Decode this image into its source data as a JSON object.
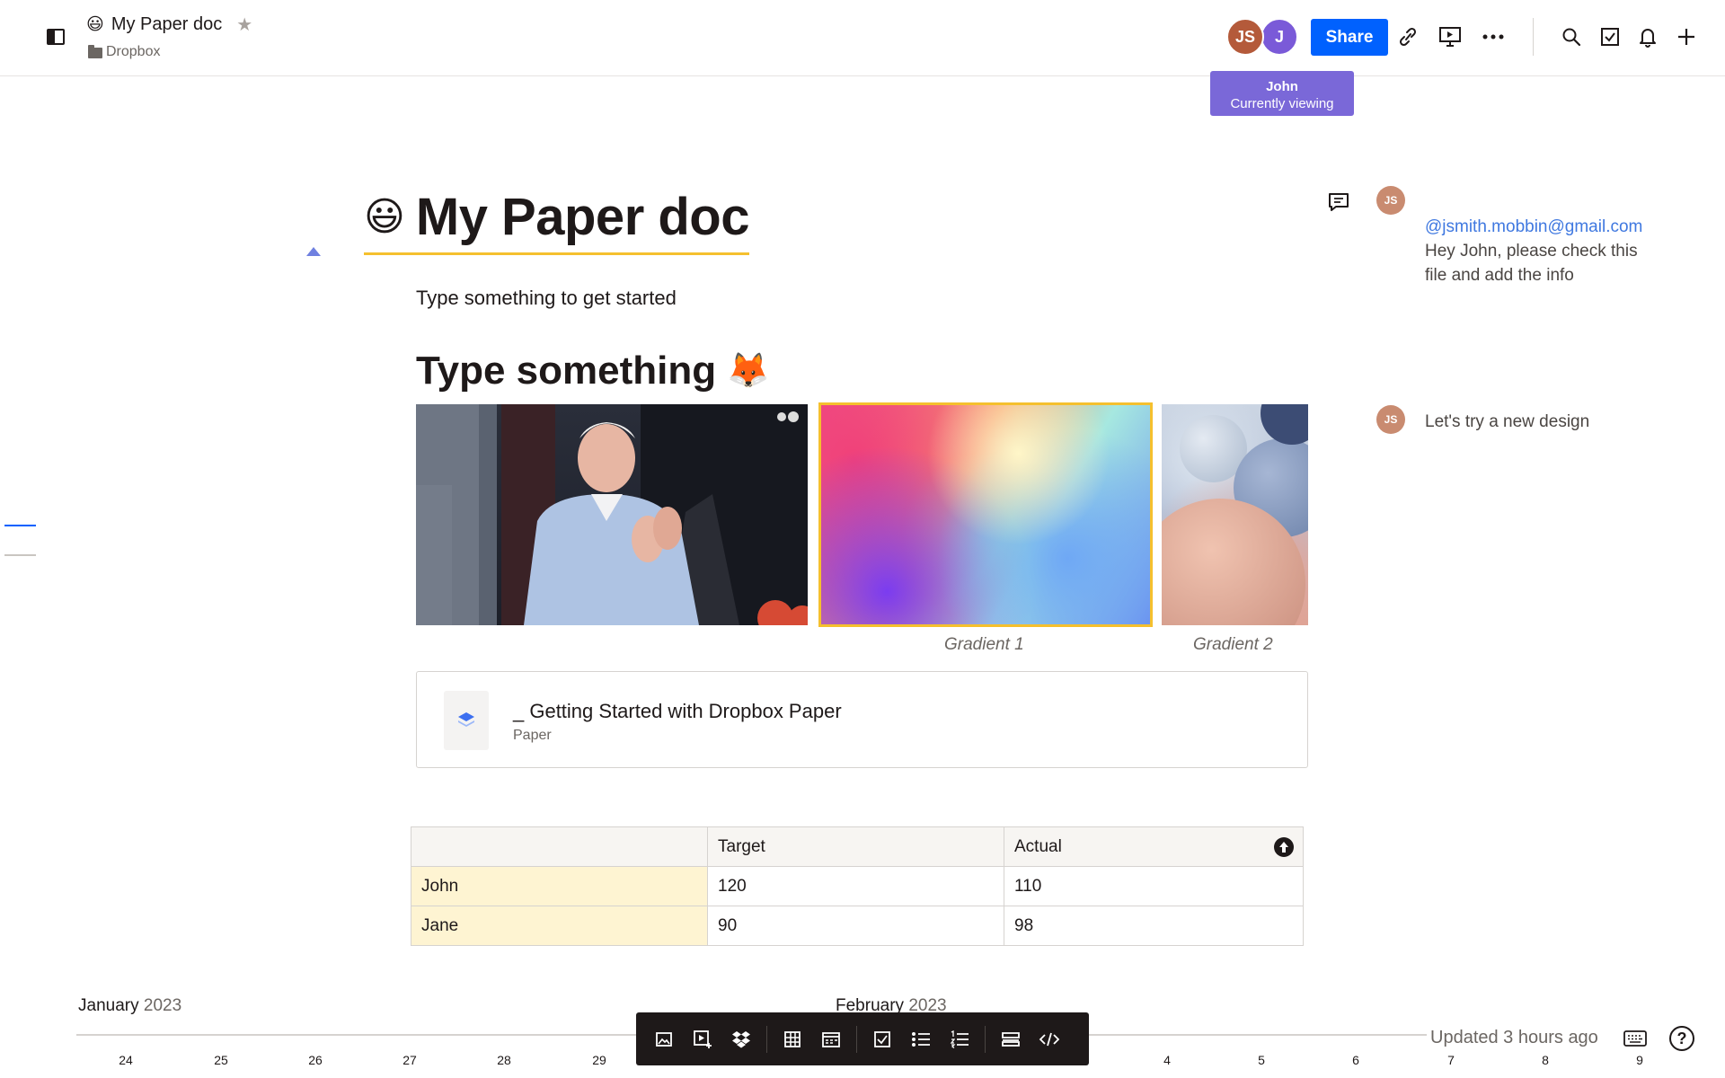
{
  "header": {
    "doc_emoji": "😃",
    "doc_title": "My Paper doc",
    "breadcrumb": "Dropbox",
    "avatars": [
      {
        "initials": "JS",
        "color": "#b45a3a"
      },
      {
        "initials": "J",
        "color": "#7a5ad8"
      }
    ],
    "tooltip": {
      "name": "John",
      "status": "Currently viewing"
    },
    "share_label": "Share",
    "icons": [
      "link-icon",
      "present-icon",
      "more-icon",
      "search-icon",
      "checklist-icon",
      "bell-icon",
      "plus-icon"
    ]
  },
  "document": {
    "title_emoji": "😃",
    "title": "My Paper doc",
    "intro": "Type something to get started",
    "heading2": "Type something",
    "heading2_emoji": "🦊",
    "images": [
      {
        "caption": ""
      },
      {
        "caption": "Gradient 1"
      },
      {
        "caption": "Gradient 2"
      }
    ],
    "link_card": {
      "title": "_ Getting Started with Dropbox Paper",
      "subtitle": "Paper"
    },
    "table": {
      "headers": [
        "",
        "Target",
        "Actual"
      ],
      "rows": [
        [
          "John",
          "120",
          "110"
        ],
        [
          "Jane",
          "90",
          "98"
        ]
      ]
    }
  },
  "comments": [
    {
      "author": "JS",
      "mention": "@jsmith.mobbin@gmail.com",
      "text": " Hey John, please check this file and add the info"
    },
    {
      "author": "JS",
      "mention": "",
      "text": "Let's try a new design"
    }
  ],
  "timeline": {
    "months": [
      {
        "name": "January",
        "year": "2023"
      },
      {
        "name": "February",
        "year": "2023"
      }
    ],
    "days": [
      "24",
      "25",
      "26",
      "27",
      "28",
      "29",
      "4",
      "5",
      "6",
      "7",
      "8",
      "9"
    ]
  },
  "toolbar": {
    "buttons": [
      "image-icon",
      "video-icon",
      "dropbox-icon",
      "table-icon",
      "timeline-icon",
      "checkbox-icon",
      "bullet-list-icon",
      "numbered-list-icon",
      "divider-icon",
      "code-icon"
    ]
  },
  "footer": {
    "updated": "Updated 3 hours ago",
    "help": "?"
  },
  "colors": {
    "accent": "#0061fe",
    "title_underline": "#f5c02e",
    "tooltip": "#7a68d8",
    "mention": "#3f78e0"
  }
}
